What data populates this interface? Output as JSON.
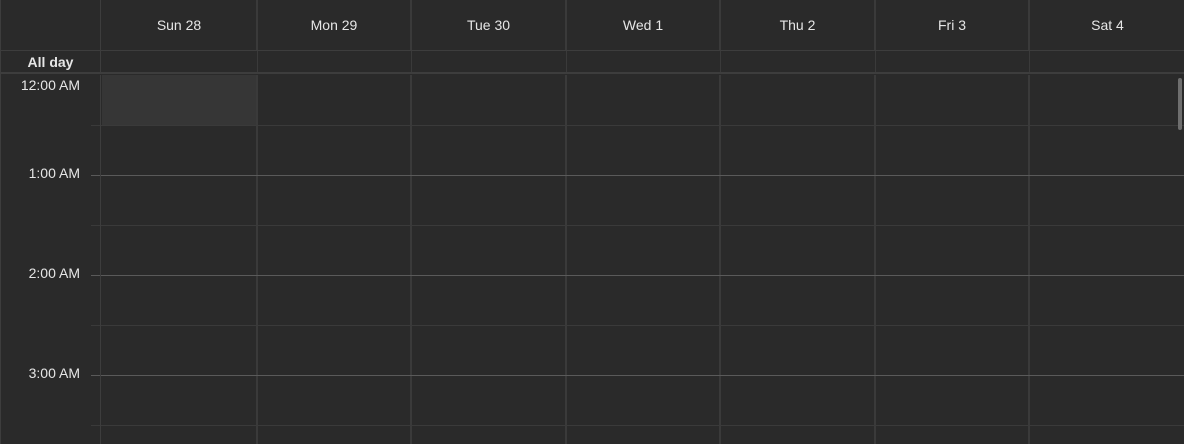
{
  "days": [
    {
      "label": "Sun 28"
    },
    {
      "label": "Mon 29"
    },
    {
      "label": "Tue 30"
    },
    {
      "label": "Wed 1"
    },
    {
      "label": "Thu 2"
    },
    {
      "label": "Fri 3"
    },
    {
      "label": "Sat 4"
    }
  ],
  "all_day_label": "All day",
  "time_labels": [
    "12:00 AM",
    "1:00 AM",
    "2:00 AM",
    "3:00 AM"
  ],
  "colors": {
    "background": "#2a2a2a",
    "grid_line": "#3a3a3a",
    "hour_line": "#5a5a5a",
    "selected_slot": "#363636",
    "text": "#e6e6e6"
  }
}
